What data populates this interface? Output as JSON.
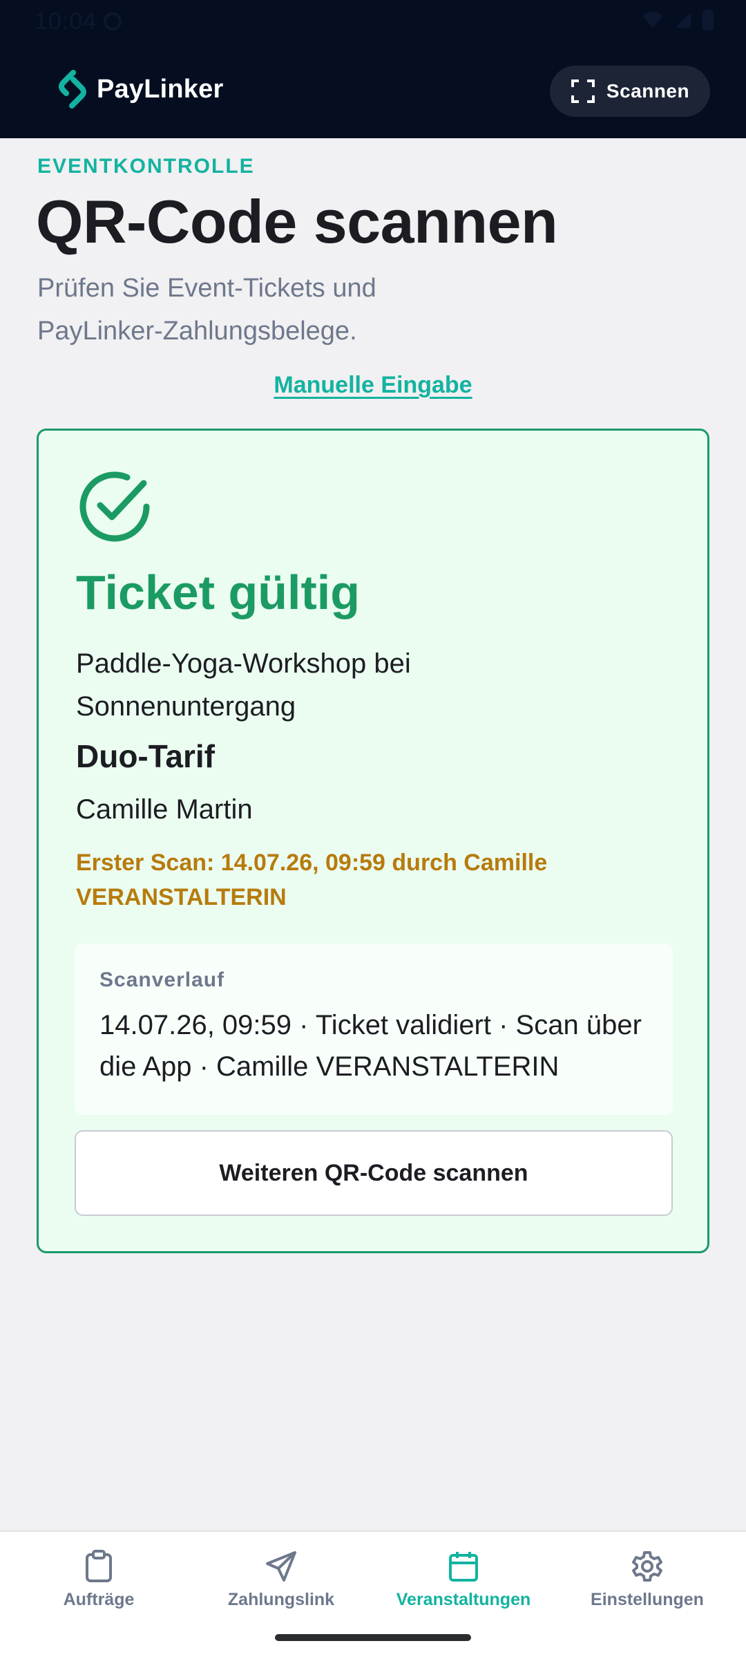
{
  "status_bar": {
    "time": "10:04"
  },
  "header": {
    "brand": "PayLinker",
    "scan_button": "Scannen"
  },
  "page": {
    "eyebrow": "EVENTKONTROLLE",
    "title": "QR-Code scannen",
    "subtitle": "Prüfen Sie Event-Tickets und PayLinker-Zahlungsbelege.",
    "manual_entry_link": "Manuelle Eingabe"
  },
  "result": {
    "status": "Ticket gültig",
    "event": "Paddle-Yoga-Workshop bei Sonnenuntergang",
    "tarif": "Duo-Tarif",
    "holder": "Camille Martin",
    "first_scan": "Erster Scan: 14.07.26, 09:59 durch Camille VERANSTALTERIN",
    "history_label": "Scanverlauf",
    "history_entry": "14.07.26, 09:59 · Ticket validiert · Scan über die App · Camille VERANSTALTERIN",
    "scan_again_button": "Weiteren QR-Code scannen"
  },
  "nav": [
    {
      "label": "Aufträge",
      "icon": "clipboard-icon",
      "active": false
    },
    {
      "label": "Zahlungslink",
      "icon": "send-icon",
      "active": false
    },
    {
      "label": "Veranstaltungen",
      "icon": "calendar-icon",
      "active": true
    },
    {
      "label": "Einstellungen",
      "icon": "gear-icon",
      "active": false
    }
  ],
  "colors": {
    "header_bg": "#050e21",
    "accent_teal": "#13b3a0",
    "success_green": "#1b9b63",
    "warning_amber": "#b77b0c",
    "card_bg": "#ebfcf1"
  }
}
